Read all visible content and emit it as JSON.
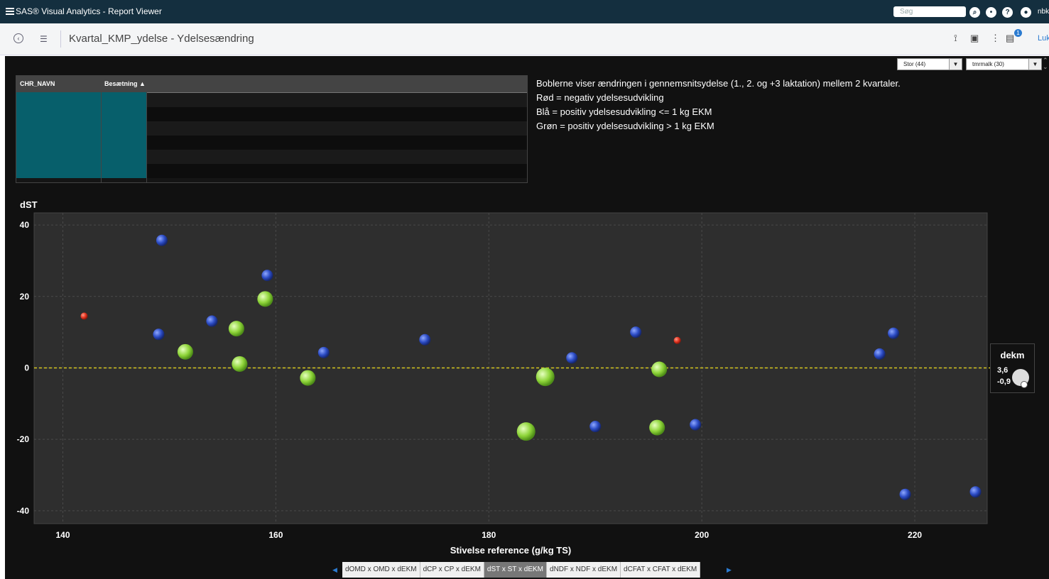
{
  "app": {
    "title": "SAS® Visual Analytics - Report Viewer",
    "search_placeholder": "Søg",
    "user": "nbk"
  },
  "toolbar": {
    "report_title": "Kvartal_KMP_ydelse - Ydelsesændring",
    "notification_count": "1",
    "close_label": "Luk"
  },
  "controls": {
    "dropdown1": "Stor (44)",
    "dropdown2": "tmrmalk (30)"
  },
  "table": {
    "columns": [
      "CHR_NAVN",
      "Besætning ▲"
    ]
  },
  "note": {
    "lines": [
      "Boblerne viser ændringen i gennemsnitsydelse (1., 2. og +3 laktation) mellem 2 kvartaler.",
      "Rød = negativ ydelsesudvikling",
      "Blå = positiv ydelsesudvikling <= 1 kg EKM",
      "Grøn = positiv ydelsesudvikling > 1 kg EKM"
    ]
  },
  "legend": {
    "title": "dekm",
    "max": "3,6",
    "min": "-0,9"
  },
  "tabs": [
    {
      "label": "dOMD x OMD x dEKM",
      "active": false
    },
    {
      "label": "dCP x CP x dEKM",
      "active": false
    },
    {
      "label": "dST x ST x dEKM",
      "active": true
    },
    {
      "label": "dNDF x NDF x dEKM",
      "active": false
    },
    {
      "label": "dCFAT x CFAT x dEKM",
      "active": false
    }
  ],
  "colors": {
    "red": "#e0321e",
    "blue": "#2b4bc4",
    "green": "#8fd53a",
    "refline": "#d4c61e"
  },
  "chart_data": {
    "type": "scatter",
    "xlabel": "Stivelse reference (g/kg TS)",
    "ylabel": "dST",
    "xlim": [
      137.3,
      226.8
    ],
    "ylim": [
      -43.6,
      43.4
    ],
    "xticks": [
      140,
      160,
      180,
      200,
      220
    ],
    "yticks": [
      40,
      20,
      0,
      -20,
      -40
    ],
    "grid": true,
    "reference_line_y": 0,
    "points": [
      {
        "x": 142,
        "y": 14.5,
        "size": "small",
        "color": "red"
      },
      {
        "x": 149.3,
        "y": 35.7,
        "size": "medium",
        "color": "blue"
      },
      {
        "x": 149,
        "y": 9.4,
        "size": "medium",
        "color": "blue"
      },
      {
        "x": 151.5,
        "y": 4.5,
        "size": "large",
        "color": "green"
      },
      {
        "x": 154,
        "y": 13.1,
        "size": "medium",
        "color": "blue"
      },
      {
        "x": 156.3,
        "y": 11,
        "size": "large",
        "color": "green"
      },
      {
        "x": 156.6,
        "y": 1.1,
        "size": "large",
        "color": "green"
      },
      {
        "x": 159,
        "y": 19.3,
        "size": "large",
        "color": "green"
      },
      {
        "x": 159.2,
        "y": 25.9,
        "size": "medium",
        "color": "blue"
      },
      {
        "x": 163,
        "y": -2.8,
        "size": "large",
        "color": "green"
      },
      {
        "x": 164.5,
        "y": 4.3,
        "size": "medium",
        "color": "blue"
      },
      {
        "x": 174,
        "y": 7.9,
        "size": "medium",
        "color": "blue"
      },
      {
        "x": 183.5,
        "y": -17.8,
        "size": "xlarge",
        "color": "green"
      },
      {
        "x": 185.3,
        "y": -2.5,
        "size": "xlarge",
        "color": "green"
      },
      {
        "x": 187.8,
        "y": 2.8,
        "size": "medium",
        "color": "blue"
      },
      {
        "x": 190,
        "y": -16.4,
        "size": "medium",
        "color": "blue"
      },
      {
        "x": 193.8,
        "y": 10,
        "size": "medium",
        "color": "blue"
      },
      {
        "x": 195.8,
        "y": -16.7,
        "size": "large",
        "color": "green"
      },
      {
        "x": 196,
        "y": -0.4,
        "size": "large",
        "color": "green"
      },
      {
        "x": 197.7,
        "y": 7.7,
        "size": "small",
        "color": "red"
      },
      {
        "x": 199.4,
        "y": -15.9,
        "size": "medium",
        "color": "blue"
      },
      {
        "x": 216.7,
        "y": 3.9,
        "size": "medium",
        "color": "blue"
      },
      {
        "x": 218,
        "y": 9.7,
        "size": "medium",
        "color": "blue"
      },
      {
        "x": 219.1,
        "y": -35.4,
        "size": "medium",
        "color": "blue"
      },
      {
        "x": 225.7,
        "y": -34.7,
        "size": "medium",
        "color": "blue"
      }
    ]
  }
}
